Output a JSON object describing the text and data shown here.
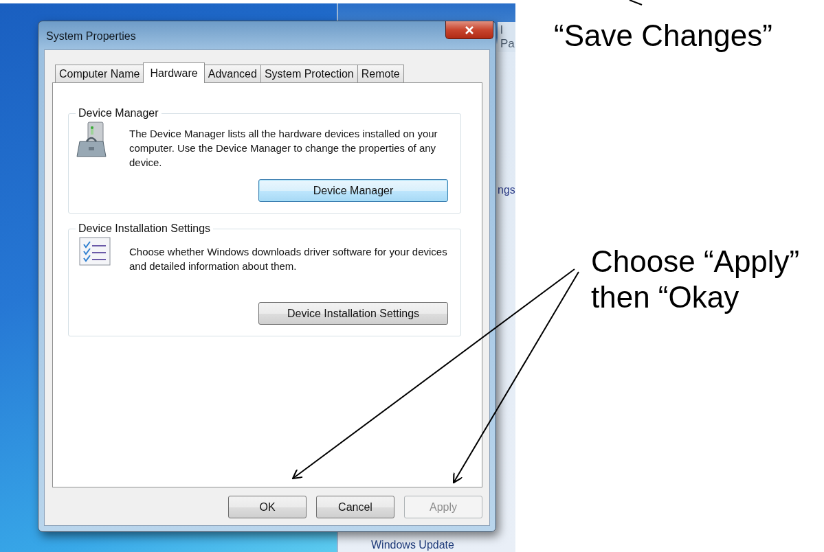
{
  "background_window": {
    "top_text": "l Pa",
    "side_text": "ngs",
    "bottom_link": "Windows Update"
  },
  "dialog": {
    "title": "System Properties",
    "tabs": [
      {
        "label": "Computer Name",
        "selected": false
      },
      {
        "label": "Hardware",
        "selected": true
      },
      {
        "label": "Advanced",
        "selected": false
      },
      {
        "label": "System Protection",
        "selected": false
      },
      {
        "label": "Remote",
        "selected": false
      }
    ],
    "groups": [
      {
        "kind": "device-manager",
        "title": "Device Manager",
        "description": "The Device Manager lists all the hardware devices installed on your computer. Use the Device Manager to change the properties of any device.",
        "button": {
          "label": "Device Manager",
          "focused": true
        }
      },
      {
        "kind": "installation",
        "title": "Device Installation Settings",
        "description": "Choose whether Windows downloads driver software for your devices and detailed information about them.",
        "button": {
          "label": "Device Installation Settings",
          "focused": false
        }
      }
    ],
    "buttons": [
      {
        "label": "OK",
        "disabled": false
      },
      {
        "label": "Cancel",
        "disabled": false
      },
      {
        "label": "Apply",
        "disabled": true
      }
    ]
  },
  "annotations": [
    {
      "text": "“Save Changes”"
    },
    {
      "text": "Choose “Apply” then “Okay"
    }
  ]
}
